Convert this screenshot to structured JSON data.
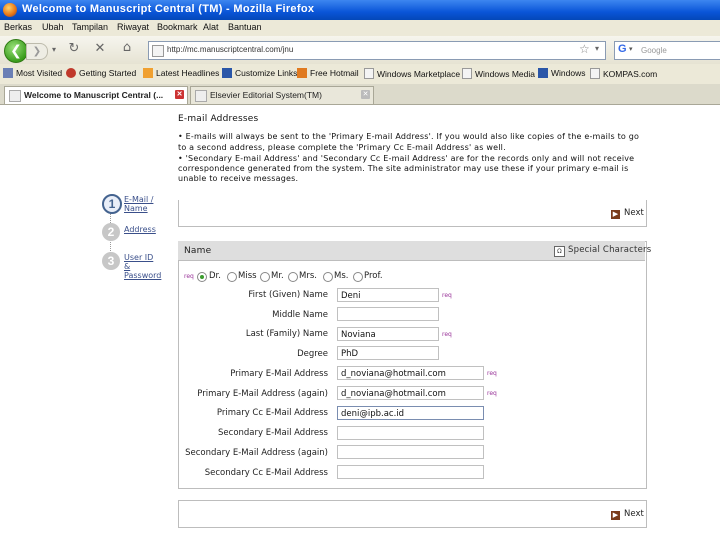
{
  "window": {
    "title": "Welcome to Manuscript Central (TM) - Mozilla Firefox"
  },
  "menu": [
    "Berkas",
    "Ubah",
    "Tampilan",
    "Riwayat",
    "Bookmark",
    "Alat",
    "Bantuan"
  ],
  "nav": {
    "url": "http://mc.manuscriptcentral.com/jnu",
    "search_placeholder": "Google",
    "search_engine_letter": "G"
  },
  "bookmarks": [
    "Most Visited",
    "Getting Started",
    "Latest Headlines",
    "Customize Links",
    "Free Hotmail",
    "Windows Marketplace",
    "Windows Media",
    "Windows",
    "KOMPAS.com"
  ],
  "tabs": [
    {
      "label": "Welcome to Manuscript Central (...",
      "active": true
    },
    {
      "label": "Elsevier Editorial System(TM)",
      "active": false
    }
  ],
  "email_section": {
    "heading": "E-mail Addresses",
    "notes": [
      "• E-mails will always be sent to the 'Primary E-mail Address'. If you would also like copies of the e-mails to go",
      "to a second address, please complete the 'Primary Cc E-mail Address' as well.",
      "• 'Secondary E-mail Address' and 'Secondary Cc E-mail Address' are for the records only and will not receive",
      "correspondence generated from the system. The site administrator may use these if your primary e-mail is",
      "unable to receive messages."
    ]
  },
  "steps": [
    {
      "number": "1",
      "label": "E-Mail /\nName",
      "active": true
    },
    {
      "number": "2",
      "label": "Address",
      "active": false
    },
    {
      "number": "3",
      "label": "User ID\n&\nPassword",
      "active": false
    }
  ],
  "next_label": "Next",
  "name_panel": {
    "title": "Name",
    "special_characters": "Special Characters",
    "req_marker": "req",
    "salutations": [
      {
        "label": "Dr.",
        "selected": true
      },
      {
        "label": "Miss",
        "selected": false
      },
      {
        "label": "Mr.",
        "selected": false
      },
      {
        "label": "Mrs.",
        "selected": false
      },
      {
        "label": "Ms.",
        "selected": false
      },
      {
        "label": "Prof.",
        "selected": false
      }
    ],
    "fields": [
      {
        "label": "First (Given) Name",
        "value": "Deni",
        "required": true
      },
      {
        "label": "Middle Name",
        "value": "",
        "required": false
      },
      {
        "label": "Last (Family) Name",
        "value": "Noviana",
        "required": true
      },
      {
        "label": "Degree",
        "value": "PhD",
        "required": false
      },
      {
        "label": "Primary E-Mail Address",
        "value": "d_noviana@hotmail.com",
        "required": true
      },
      {
        "label": "Primary E-Mail Address (again)",
        "value": "d_noviana@hotmail.com",
        "required": true
      },
      {
        "label": "Primary Cc E-Mail Address",
        "value": "deni@ipb.ac.id",
        "required": false
      },
      {
        "label": "Secondary E-Mail Address",
        "value": "",
        "required": false
      },
      {
        "label": "Secondary E-Mail Address (again)",
        "value": "",
        "required": false
      },
      {
        "label": "Secondary Cc E-Mail Address",
        "value": "",
        "required": false
      }
    ]
  },
  "colors": {
    "titlebar": "#0a55d8",
    "accent_green": "#3a9c2e",
    "step_active": "#44638f",
    "required": "#993399"
  }
}
